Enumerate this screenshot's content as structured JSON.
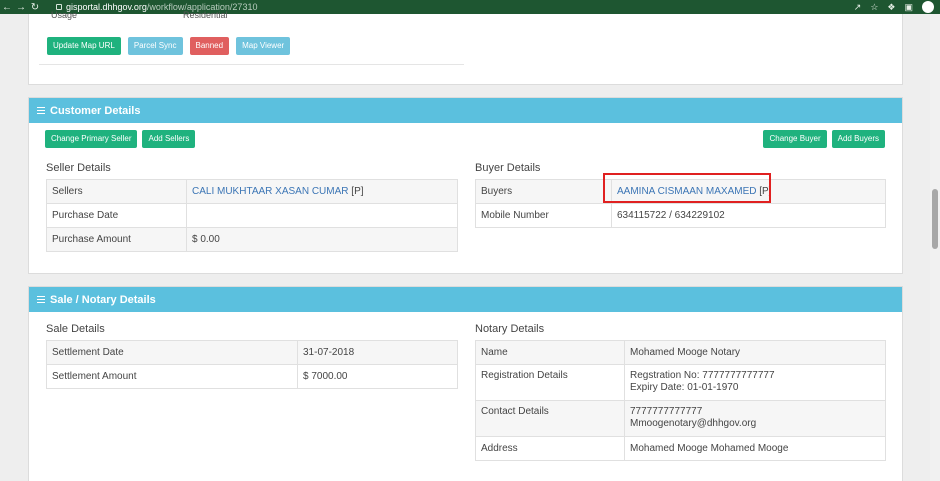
{
  "browser": {
    "url_host": "gisportal.dhhgov.org",
    "url_path": "/workflow/application/27310"
  },
  "top": {
    "usage_label": "Usage",
    "usage_value": "Residential",
    "buttons": {
      "update_map_url": "Update Map URL",
      "parcel_sync": "Parcel Sync",
      "banned": "Banned",
      "map_viewer": "Map Viewer"
    }
  },
  "customer": {
    "title": "Customer Details",
    "change_primary_seller": "Change Primary Seller",
    "add_sellers": "Add Sellers",
    "change_buyer": "Change Buyer",
    "add_buyers": "Add Buyers",
    "seller_heading": "Seller Details",
    "buyer_heading": "Buyer Details",
    "seller_rows": {
      "sellers_label": "Sellers",
      "sellers_name": "CALI MUKHTAAR XASAN CUMAR",
      "sellers_tag": "[P]",
      "purchase_date_label": "Purchase Date",
      "purchase_date_value": "",
      "purchase_amount_label": "Purchase Amount",
      "purchase_amount_value": "$ 0.00"
    },
    "buyer_rows": {
      "buyers_label": "Buyers",
      "buyers_name": "AAMINA CISMAAN MAXAMED",
      "buyers_tag": "[P]",
      "mobile_label": "Mobile Number",
      "mobile_value": "634115722 / 634229102"
    }
  },
  "sale": {
    "title": "Sale / Notary Details",
    "sale_heading": "Sale Details",
    "notary_heading": "Notary Details",
    "sale_rows": {
      "settlement_date_label": "Settlement Date",
      "settlement_date_value": "31-07-2018",
      "settlement_amount_label": "Settlement Amount",
      "settlement_amount_value": "$ 7000.00"
    },
    "notary_rows": {
      "name_label": "Name",
      "name_value": "Mohamed Mooge Notary",
      "registration_label": "Registration Details",
      "registration_no": "Regstration No: 7777777777777",
      "expiry_date": "Expiry Date: 01-01-1970",
      "contact_label": "Contact Details",
      "contact_phone": "7777777777777",
      "contact_email": "Mmoogenotary@dhhgov.org",
      "address_label": "Address",
      "address_value": "Mohamed Mooge Mohamed Mooge"
    }
  },
  "colors": {
    "browser_bar": "#1e5631",
    "panel_header": "#5bc0de",
    "button_green": "#1fb27e",
    "button_blue": "#6fc3dd",
    "button_red": "#e05f5f",
    "link": "#3b75b5",
    "highlight": "#e02020"
  },
  "icons": [
    "back-icon",
    "forward-icon",
    "reload-icon",
    "lock-icon",
    "share-icon",
    "star-icon",
    "extensions-icon",
    "sidebar-icon",
    "profile-avatar",
    "list-icon"
  ]
}
